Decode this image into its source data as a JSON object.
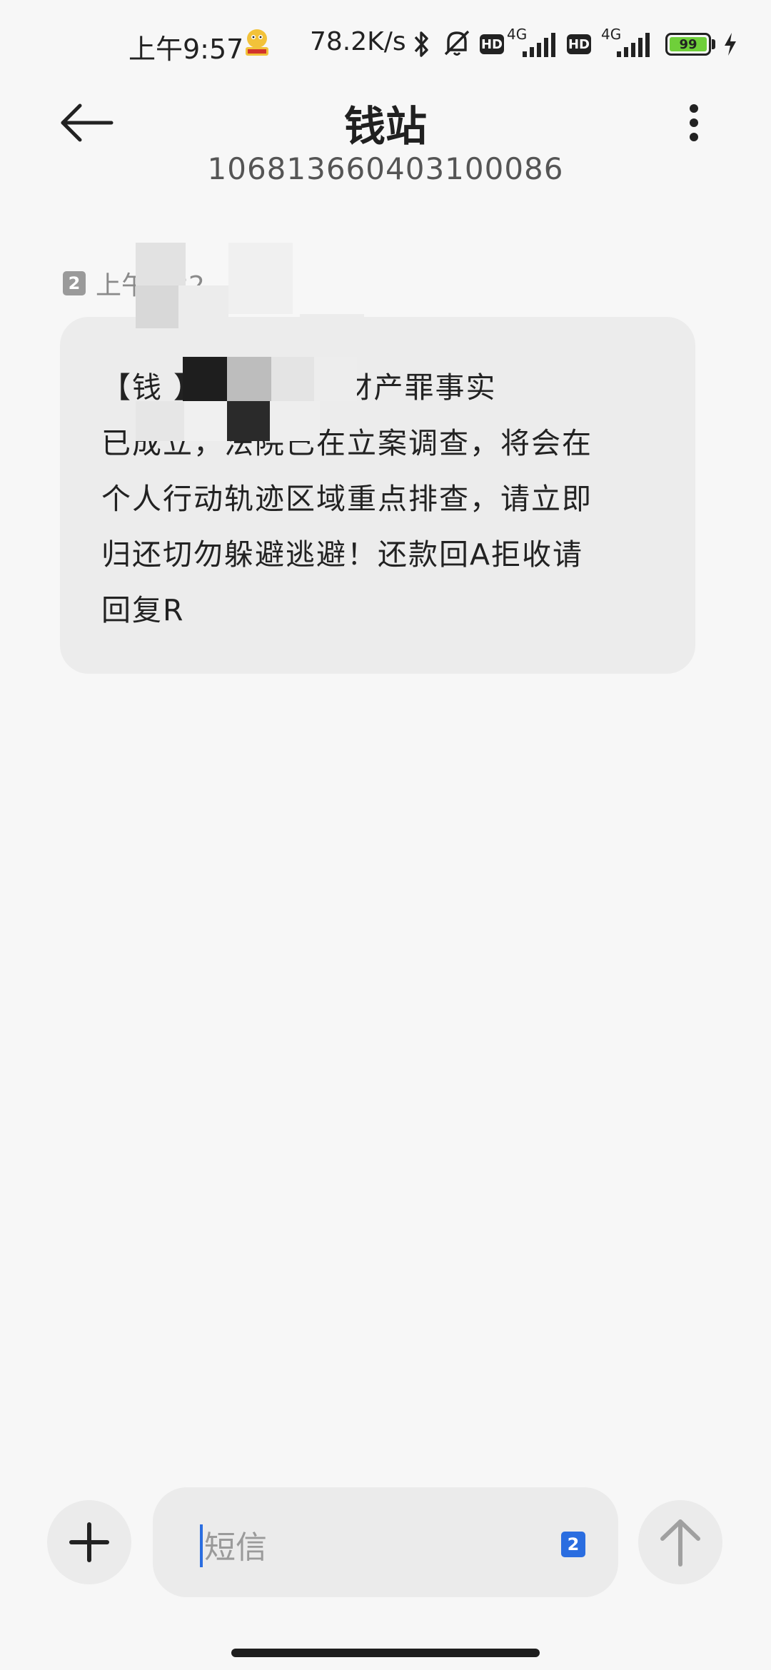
{
  "status_bar": {
    "time": "上午9:57",
    "net_speed": "78.2K/s",
    "sim1_network": "4G",
    "sim2_network": "4G",
    "sim1_hd": "HD",
    "sim2_hd": "HD",
    "battery_level": "99",
    "icons": [
      "mascot-icon",
      "bluetooth-icon",
      "mute-bell-icon",
      "hd-icon",
      "signal-icon",
      "hd-icon",
      "signal-icon",
      "battery-icon",
      "charging-icon"
    ]
  },
  "header": {
    "title": "钱站",
    "number": "106813660403100086",
    "back_icon": "arrow-left-icon",
    "more_icon": "more-vertical-icon"
  },
  "message": {
    "sim_badge": "2",
    "time": "上午9:32",
    "lines": [
      "【钱     】，侵占旅行财产罪事实",
      "已成立，法院已在立案调查，将会在",
      "个人行动轨迹区域重点排查，请立即",
      "归还切勿躲避逃避！还款回A拒收请",
      "回复R"
    ]
  },
  "compose": {
    "placeholder": "短信",
    "sim_badge": "2",
    "plus_icon": "plus-icon",
    "send_icon": "arrow-up-icon"
  },
  "colors": {
    "background": "#f7f7f7",
    "bubble": "#ececec",
    "accent": "#2a6de0",
    "battery": "#6fcf3a"
  }
}
